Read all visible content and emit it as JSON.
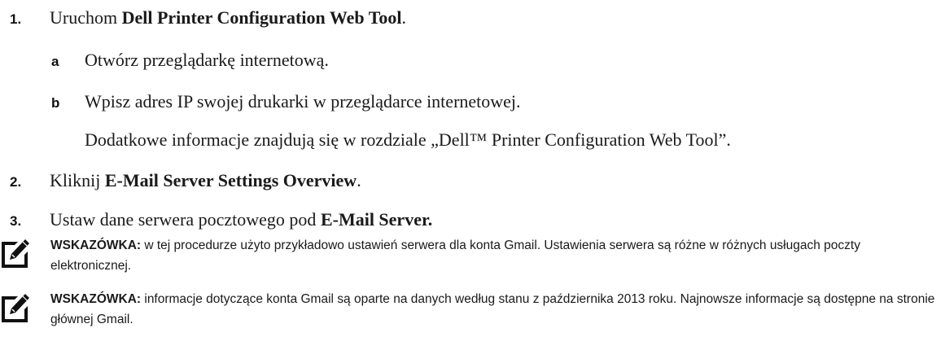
{
  "steps": [
    {
      "num": "1.",
      "text_prefix": "Uruchom ",
      "text_bold": "Dell Printer Configuration Web Tool",
      "text_suffix": ".",
      "substeps": [
        {
          "letter": "a",
          "text": "Otwórz przeglądarkę internetową."
        },
        {
          "letter": "b",
          "text": "Wpisz adres IP swojej drukarki w przeglądarce internetowej.",
          "continuation": "Dodatkowe informacje znajdują się w rozdziale „Dell™ Printer Configuration Web Tool”."
        }
      ]
    },
    {
      "num": "2.",
      "text_prefix": "Kliknij ",
      "text_bold": "E-Mail Server Settings Overview",
      "text_suffix": "."
    },
    {
      "num": "3.",
      "text_prefix": "Ustaw dane serwera pocztowego pod ",
      "text_bold": "E-Mail Server.",
      "text_suffix": ""
    }
  ],
  "notes": [
    {
      "icon": "pencil-note-icon",
      "label": "WSKAZÓWKA:",
      "text": " w tej procedurze użyto przykładowo ustawień serwera dla konta Gmail. Ustawienia serwera są różne w różnych usługach poczty elektronicznej."
    },
    {
      "icon": "pencil-note-icon",
      "label": "WSKAZÓWKA:",
      "text": " informacje dotyczące konta Gmail są oparte na danych według stanu z października 2013 roku. Najnowsze informacje są dostępne na stronie głównej Gmail."
    }
  ]
}
